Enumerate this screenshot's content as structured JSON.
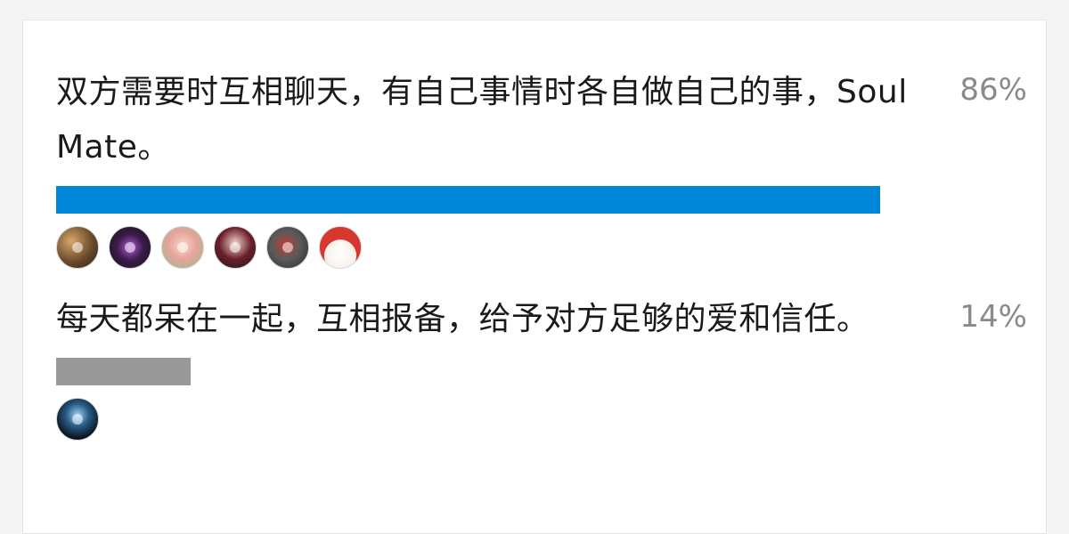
{
  "poll": {
    "options": [
      {
        "text": "双方需要时互相聊天，有自己事情时各自做自己的事，Soul Mate。",
        "percent_label": "86%",
        "fraction": 0.86,
        "bar_color": "#0086d6",
        "voter_avatars": [
          "avatar-1",
          "avatar-2",
          "avatar-3",
          "avatar-4",
          "avatar-5",
          "avatar-6"
        ]
      },
      {
        "text": "每天都呆在一起，互相报备，给予对方足够的爱和信任。",
        "percent_label": "14%",
        "fraction": 0.14,
        "bar_color": "#999999",
        "voter_avatars": [
          "avatar-7"
        ]
      }
    ]
  }
}
